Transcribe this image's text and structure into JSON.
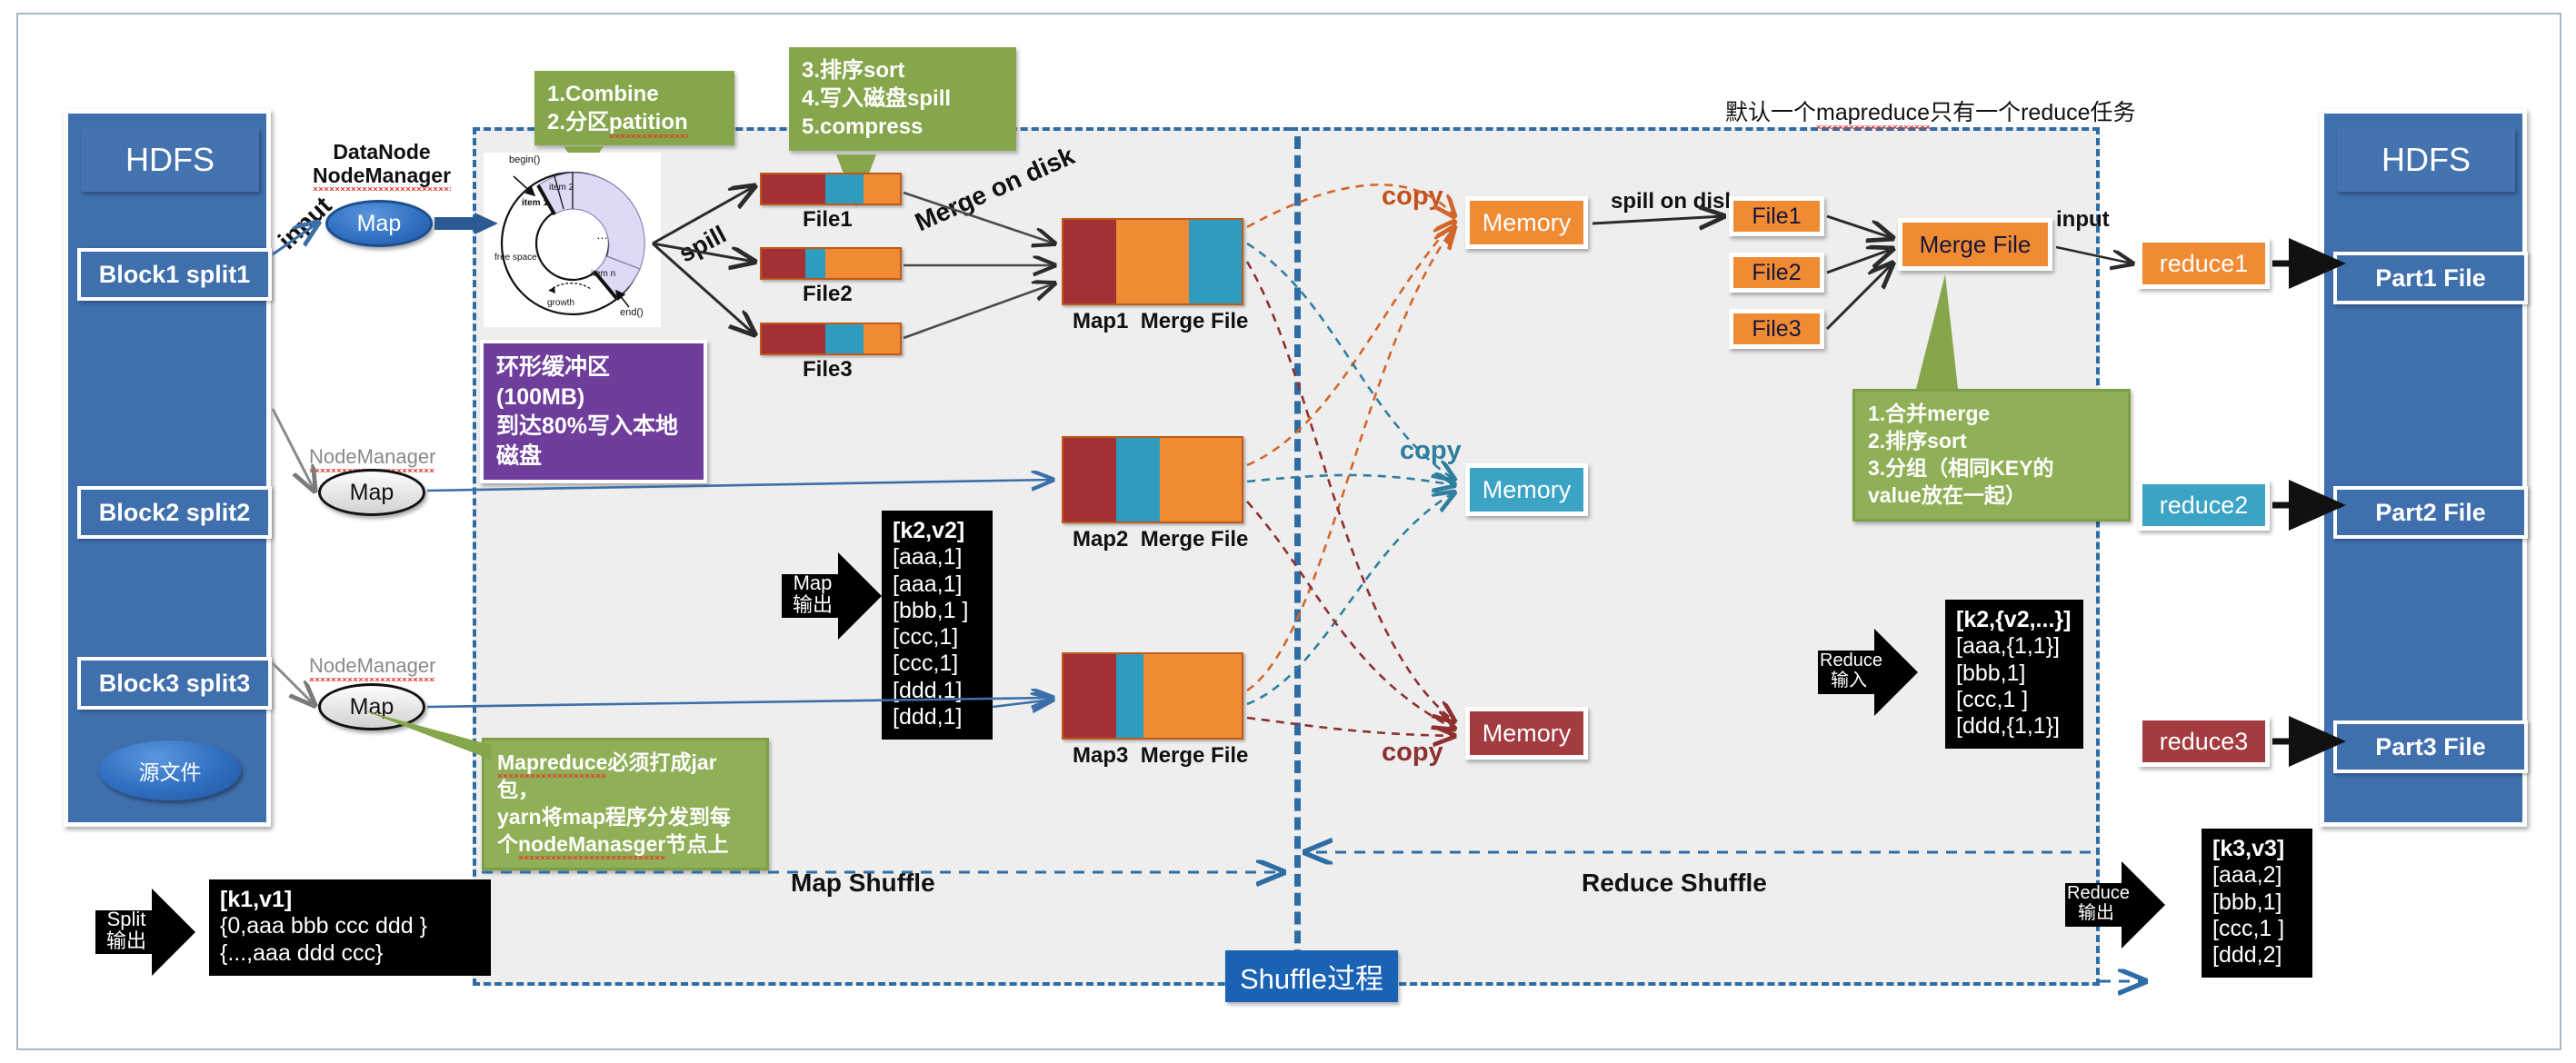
{
  "hdfs_left": {
    "title": "HDFS",
    "blocks": [
      "Block1 split1",
      "Block2 split2",
      "Block3 split3"
    ],
    "source_label": "源文件"
  },
  "hdfs_right": {
    "title": "HDFS",
    "parts": [
      "Part1 File",
      "Part2 File",
      "Part3 File"
    ]
  },
  "nodes": {
    "first_label_line1": "DataNode",
    "first_label_line2": "NodeManager",
    "other_label": "NodeManager",
    "map_label": "Map",
    "input_label": "input"
  },
  "callouts": {
    "combine": "1.Combine\n2.分区patition",
    "combine_line1": "1.Combine",
    "combine_line2_a": "2.分区",
    "combine_line2_b": "patition",
    "sort_line1": "3.排序sort",
    "sort_line2": "4.写入磁盘spill",
    "sort_line3": "5.compress",
    "buffer_line1": "环形缓冲区(100MB)",
    "buffer_line2": "到达80%写入本地磁盘",
    "yarn_line1_a": "Mapreduce",
    "yarn_line1_b": "必须打成jar包，",
    "yarn_line2": "yarn将map程序分发到每",
    "yarn_line3_a": "个",
    "yarn_line3_b": "nodeManasger",
    "yarn_line3_c": "节点上",
    "merge_line1": "1.合并merge",
    "merge_line2": "2.排序sort",
    "merge_line3": "3.分组（相同KEY的",
    "merge_line4": "value放在一起）"
  },
  "ring_buffer": {
    "begin": "begin()",
    "end": "end()",
    "item1": "item 1",
    "item2": "item 2",
    "itemn": "item n",
    "ellipsis": "…",
    "free_space": "free space",
    "growth": "growth"
  },
  "map_side": {
    "spill_label": "spill",
    "merge_on_disk_label": "Merge on disk",
    "spill_files": [
      "File1",
      "File2",
      "File3"
    ],
    "merge_files": [
      "Map1  Merge File",
      "Map2  Merge File",
      "Map3  Merge File"
    ],
    "map1_caption_a": "Map1",
    "map1_caption_b": "Merge File",
    "map2_caption_a": "Map2",
    "map2_caption_b": "Merge File",
    "map3_caption_a": "Map3",
    "map3_caption_b": "Merge File"
  },
  "reduce_side": {
    "top_note": "默认一个mapreduce只有一个reduce任务",
    "top_note_a": "默认一个",
    "top_note_b": "mapreduce",
    "top_note_c": "只有一个reduce任务",
    "copy_label": "copy",
    "memory_label": "Memory",
    "spill_on_disk_label": "spill on disk",
    "files": [
      "File1",
      "File2",
      "File3"
    ],
    "merge_file_label": "Merge File",
    "input_label": "input",
    "reducers": [
      "reduce1",
      "reduce2",
      "reduce3"
    ]
  },
  "data_boxes": {
    "split_out": {
      "arrow_l1": "Split",
      "arrow_l2": "输出",
      "lines": [
        "[k1,v1]",
        "{0,aaa  bbb  ccc  ddd }",
        "{...,aaa  ddd ccc}"
      ]
    },
    "map_out": {
      "arrow_l1": "Map",
      "arrow_l2": "输出",
      "lines": [
        "[k2,v2]",
        "[aaa,1]",
        "[aaa,1]",
        "[bbb,1 ]",
        "[ccc,1]",
        "[ccc,1]",
        "[ddd,1]",
        "[ddd,1]"
      ]
    },
    "reduce_in": {
      "arrow_l1": "Reduce",
      "arrow_l2": "输入",
      "lines": [
        "[k2,{v2,...}]",
        "[aaa,{1,1}]",
        "[bbb,1]",
        "[ccc,1 ]",
        "[ddd,{1,1}]"
      ]
    },
    "reduce_out": {
      "arrow_l1": "Reduce",
      "arrow_l2": "输出",
      "lines": [
        "[k3,v3]",
        "[aaa,2]",
        "[bbb,1]",
        "[ccc,1 ]",
        "[ddd,2]"
      ]
    }
  },
  "stages": {
    "map_shuffle": "Map Shuffle",
    "reduce_shuffle": "Reduce Shuffle",
    "shuffle_chip": "Shuffle过程"
  },
  "colors": {
    "hdfs_blue": "#3f6fad",
    "orange": "#f08b33",
    "teal": "#3ba4c4",
    "dark_red": "#a33c40",
    "green_callout": "#85a64a",
    "purple_callout": "#6f3d9c",
    "dash_blue": "#2e6da4",
    "copy_orange": "#c4511b",
    "band_grey": "#eeeeee"
  }
}
